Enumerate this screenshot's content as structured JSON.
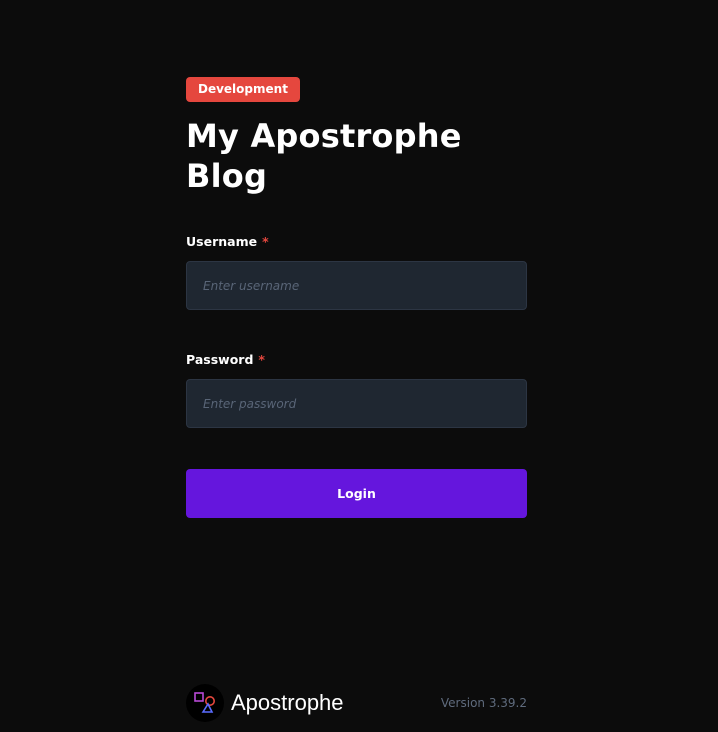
{
  "env_badge": "Development",
  "title": "My Apostrophe Blog",
  "username": {
    "label": "Username",
    "required_mark": "*",
    "placeholder": "Enter username",
    "value": ""
  },
  "password": {
    "label": "Password",
    "required_mark": "*",
    "placeholder": "Enter password",
    "value": ""
  },
  "login_button": "Login",
  "footer": {
    "brand_name": "Apostrophe",
    "logo_icon": "apostrophe-logo-icon",
    "version": "Version 3.39.2"
  },
  "colors": {
    "background": "#0c0c0c",
    "badge": "#e5473e",
    "input_bg": "#1f2731",
    "primary": "#6516dd"
  }
}
